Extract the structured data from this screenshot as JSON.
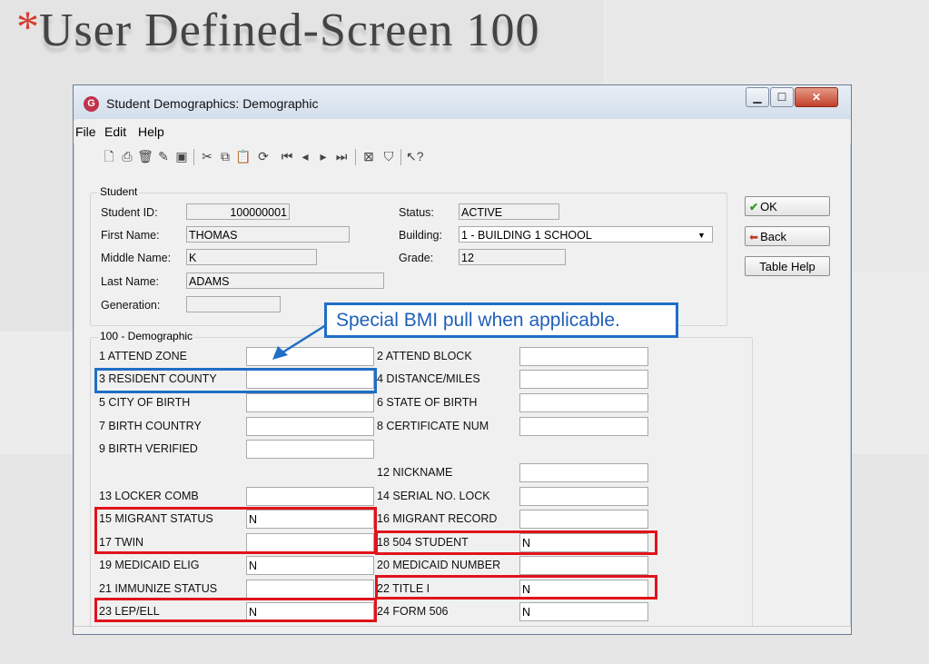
{
  "slide": {
    "bullet": "*",
    "title": "User Defined-Screen 100"
  },
  "window": {
    "title": "Student Demographics: Demographic",
    "icon": "app-logo-icon"
  },
  "menu": [
    "File",
    "Edit",
    "Help"
  ],
  "toolbar_icons": [
    "new-icon",
    "print-icon",
    "delete-icon",
    "open-icon",
    "save-icon",
    "cut-icon",
    "copy-icon",
    "paste-icon",
    "refresh-icon",
    "first-record-icon",
    "prev-record-icon",
    "next-record-icon",
    "last-record-icon",
    "exit-icon",
    "filter-icon",
    "help-pointer-icon"
  ],
  "student": {
    "group_label": "Student",
    "id_label": "Student ID:",
    "id": "100000001",
    "first_label": "First Name:",
    "first": "THOMAS",
    "middle_label": "Middle Name:",
    "middle": "K",
    "last_label": "Last Name:",
    "last": "ADAMS",
    "gen_label": "Generation:",
    "gen": "",
    "status_label": "Status:",
    "status": "ACTIVE",
    "building_label": "Building:",
    "building": "1 - BUILDING 1 SCHOOL",
    "grade_label": "Grade:",
    "grade": "12"
  },
  "buttons": {
    "ok": "OK",
    "back": "Back",
    "table_help": "Table Help"
  },
  "demo": {
    "group_label": "100 - Demographic",
    "left": [
      {
        "label": "1  ATTEND ZONE",
        "value": ""
      },
      {
        "label": "3  RESIDENT COUNTY",
        "value": ""
      },
      {
        "label": "5  CITY OF BIRTH",
        "value": ""
      },
      {
        "label": "7  BIRTH COUNTRY",
        "value": ""
      },
      {
        "label": "9  BIRTH VERIFIED",
        "value": ""
      },
      {
        "label": "",
        "value": ""
      },
      {
        "label": "13 LOCKER COMB",
        "value": ""
      },
      {
        "label": "15 MIGRANT STATUS",
        "value": "N"
      },
      {
        "label": "17 TWIN",
        "value": ""
      },
      {
        "label": "19 MEDICAID ELIG",
        "value": "N"
      },
      {
        "label": "21 IMMUNIZE STATUS",
        "value": ""
      },
      {
        "label": "23 LEP/ELL",
        "value": "N"
      }
    ],
    "right": [
      {
        "label": "2  ATTEND BLOCK",
        "value": ""
      },
      {
        "label": "4  DISTANCE/MILES",
        "value": ""
      },
      {
        "label": "6  STATE OF BIRTH",
        "value": ""
      },
      {
        "label": "8  CERTIFICATE NUM",
        "value": ""
      },
      {
        "label": "",
        "value": ""
      },
      {
        "label": "12 NICKNAME",
        "value": ""
      },
      {
        "label": "14 SERIAL NO. LOCK",
        "value": ""
      },
      {
        "label": "16 MIGRANT RECORD",
        "value": ""
      },
      {
        "label": "18 504 STUDENT",
        "value": "N"
      },
      {
        "label": "20 MEDICAID NUMBER",
        "value": ""
      },
      {
        "label": "22 TITLE I",
        "value": "N"
      },
      {
        "label": "24 FORM 506",
        "value": "N"
      }
    ]
  },
  "callout": "Special BMI pull when applicable.",
  "colors": {
    "highlight_red": "#e0141b",
    "highlight_blue": "#1f6fc6"
  }
}
